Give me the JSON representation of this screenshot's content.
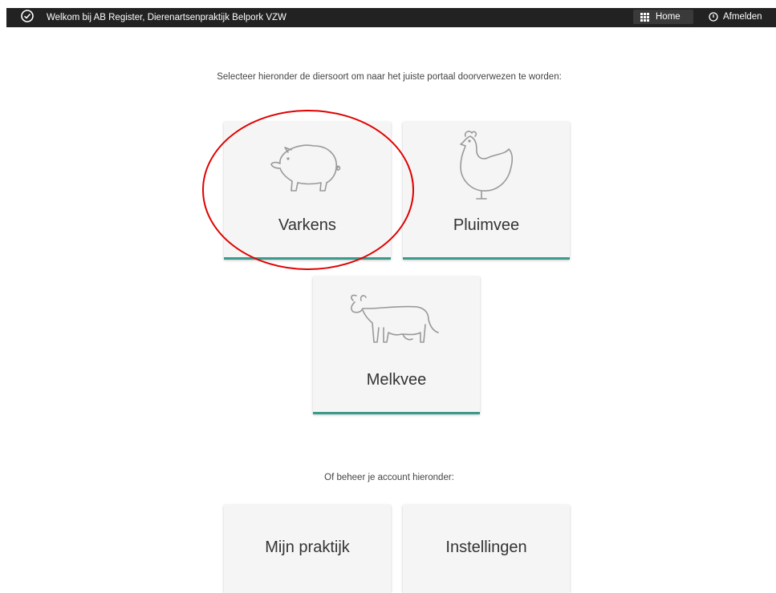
{
  "header": {
    "welcome_text": "Welkom bij AB Register, Dierenartsenpraktijk Belpork VZW",
    "home_label": "Home",
    "logout_label": "Afmelden"
  },
  "main": {
    "intro_text": "Selecteer hieronder de diersoort om naar het juiste portaal doorverwezen te worden:",
    "species": [
      {
        "label": "Varkens",
        "icon": "pig-icon"
      },
      {
        "label": "Pluimvee",
        "icon": "chicken-icon"
      },
      {
        "label": "Melkvee",
        "icon": "cow-icon"
      }
    ],
    "account_text": "Of beheer je account hieronder:",
    "account_tiles": [
      {
        "label": "Mijn praktijk"
      },
      {
        "label": "Instellingen"
      }
    ]
  },
  "colors": {
    "topbar": "#222222",
    "accent": "#3a9a8c",
    "annotation": "#e00000"
  }
}
